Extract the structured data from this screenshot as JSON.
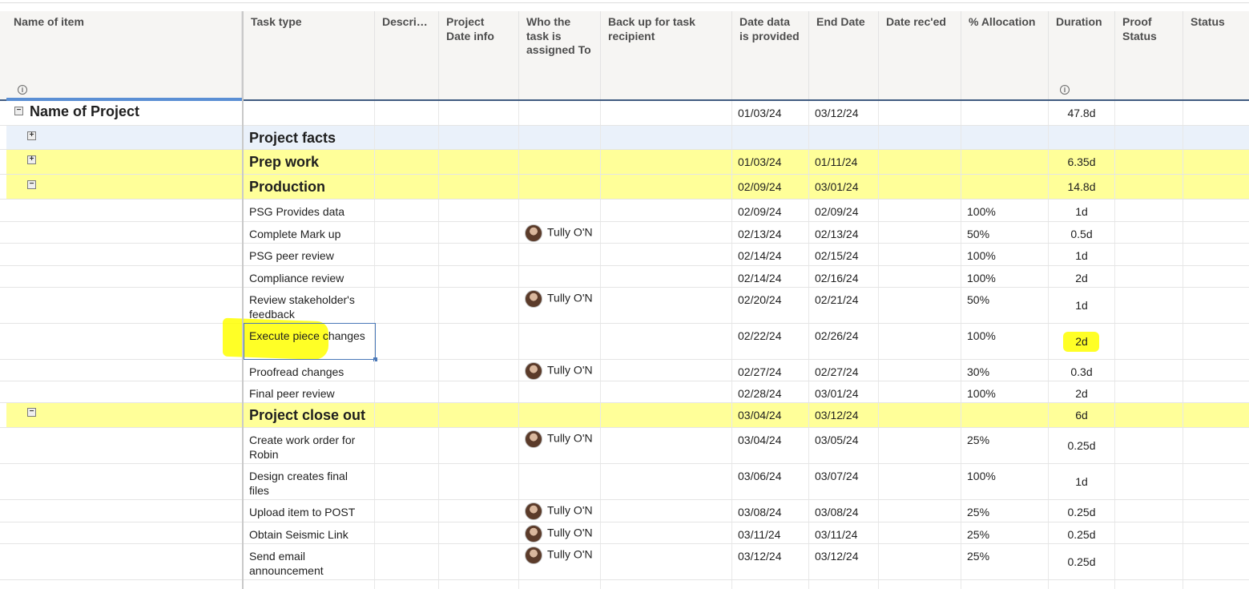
{
  "columns": {
    "name_of_item": "Name of item",
    "task_type": "Task type",
    "description": "Descri…",
    "project_date_info": "Project Date info",
    "assigned_to": "Who the task is assigned To",
    "backup": "Back up for task recipient",
    "date_data_provided": "Date data is provided",
    "end_date": "End Date",
    "date_reced": "Date rec'ed",
    "allocation": "% Allocation",
    "duration": "Duration",
    "proof_status": "Proof Status",
    "status": "Status"
  },
  "icons": {
    "info": "info-icon",
    "expand": "plus-box-icon",
    "collapse": "minus-box-icon",
    "avatar": "user-avatar"
  },
  "colors": {
    "group_highlight": "#ffff99",
    "marker": "#ffff00",
    "header_border": "#3f5a80",
    "selection": "#4a78b8",
    "facts_row": "#eaf1fa"
  },
  "project": {
    "name": "Name of Project",
    "start": "01/03/24",
    "end": "03/12/24",
    "duration": "47.8d"
  },
  "groups": {
    "facts": {
      "label": "Project facts"
    },
    "prep": {
      "label": "Prep work",
      "start": "01/03/24",
      "end": "01/11/24",
      "duration": "6.35d"
    },
    "production": {
      "label": "Production",
      "start": "02/09/24",
      "end": "03/01/24",
      "duration": "14.8d"
    },
    "closeout": {
      "label": "Project close out",
      "start": "03/04/24",
      "end": "03/12/24",
      "duration": "6d"
    }
  },
  "tasks": [
    {
      "task": "PSG Provides data",
      "assignee": "",
      "start": "02/09/24",
      "end": "02/09/24",
      "allocation": "100%",
      "duration": "1d"
    },
    {
      "task": "Complete Mark up",
      "assignee": "Tully O'N",
      "start": "02/13/24",
      "end": "02/13/24",
      "allocation": "50%",
      "duration": "0.5d"
    },
    {
      "task": "PSG peer review",
      "assignee": "",
      "start": "02/14/24",
      "end": "02/15/24",
      "allocation": "100%",
      "duration": "1d"
    },
    {
      "task": "Compliance review",
      "assignee": "",
      "start": "02/14/24",
      "end": "02/16/24",
      "allocation": "100%",
      "duration": "2d"
    },
    {
      "task": "Review stakeholder's feedback",
      "assignee": "Tully O'N",
      "start": "02/20/24",
      "end": "02/21/24",
      "allocation": "50%",
      "duration": "1d"
    },
    {
      "task": "Execute piece changes",
      "assignee": "",
      "start": "02/22/24",
      "end": "02/26/24",
      "allocation": "100%",
      "duration": "2d"
    },
    {
      "task": "Proofread changes",
      "assignee": "Tully O'N",
      "start": "02/27/24",
      "end": "02/27/24",
      "allocation": "30%",
      "duration": "0.3d"
    },
    {
      "task": "Final peer review",
      "assignee": "",
      "start": "02/28/24",
      "end": "03/01/24",
      "allocation": "100%",
      "duration": "2d"
    },
    {
      "task": "Create work order for Robin",
      "assignee": "Tully O'N",
      "start": "03/04/24",
      "end": "03/05/24",
      "allocation": "25%",
      "duration": "0.25d"
    },
    {
      "task": "Design creates final files",
      "assignee": "",
      "start": "03/06/24",
      "end": "03/07/24",
      "allocation": "100%",
      "duration": "1d"
    },
    {
      "task": "Upload item to POST",
      "assignee": "Tully O'N",
      "start": "03/08/24",
      "end": "03/08/24",
      "allocation": "25%",
      "duration": "0.25d"
    },
    {
      "task": "Obtain Seismic Link",
      "assignee": "Tully O'N",
      "start": "03/11/24",
      "end": "03/11/24",
      "allocation": "25%",
      "duration": "0.25d"
    },
    {
      "task": "Send email announcement",
      "assignee": "Tully O'N",
      "start": "03/12/24",
      "end": "03/12/24",
      "allocation": "25%",
      "duration": "0.25d"
    }
  ]
}
